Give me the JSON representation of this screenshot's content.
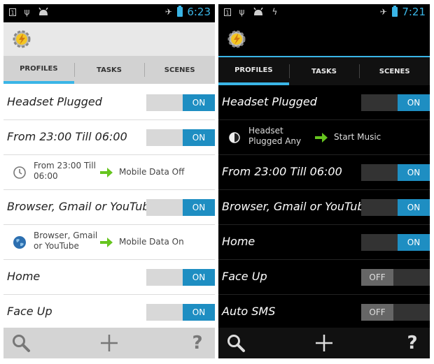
{
  "light": {
    "status": {
      "time": "6:23"
    },
    "tabs": [
      "PROFILES",
      "TASKS",
      "SCENES"
    ],
    "profiles": [
      {
        "name": "Headset Plugged",
        "toggle": "ON"
      },
      {
        "name": "From 23:00 Till 06:00",
        "toggle": "ON",
        "detail": {
          "condition_icon": "clock-icon",
          "condition": "From 23:00 Till 06:00",
          "task": "Mobile Data Off"
        }
      },
      {
        "name": "Browser, Gmail or YouTube",
        "toggle": "ON",
        "detail": {
          "condition_icon": "globe-icon",
          "condition": "Browser, Gmail or YouTube",
          "task": "Mobile Data On"
        }
      },
      {
        "name": "Home",
        "toggle": "ON"
      },
      {
        "name": "Face Up",
        "toggle": "ON"
      }
    ]
  },
  "dark": {
    "status": {
      "time": "7:21"
    },
    "tabs": [
      "PROFILES",
      "TASKS",
      "SCENES"
    ],
    "profiles": [
      {
        "name": "Headset Plugged",
        "toggle": "ON",
        "detail": {
          "condition_icon": "half-circle-icon",
          "condition": "Headset Plugged Any",
          "task": "Start Music"
        }
      },
      {
        "name": "From 23:00 Till 06:00",
        "toggle": "ON"
      },
      {
        "name": "Browser, Gmail or YouTube",
        "toggle": "ON"
      },
      {
        "name": "Home",
        "toggle": "ON"
      },
      {
        "name": "Face Up",
        "toggle": "OFF"
      },
      {
        "name": "Auto SMS",
        "toggle": "OFF"
      }
    ]
  },
  "colors": {
    "accent": "#3ab5e6",
    "toggle_on": "#1e8ec2",
    "arrow": "#66c51f"
  },
  "bottom_bar": {
    "help_label": "?"
  }
}
